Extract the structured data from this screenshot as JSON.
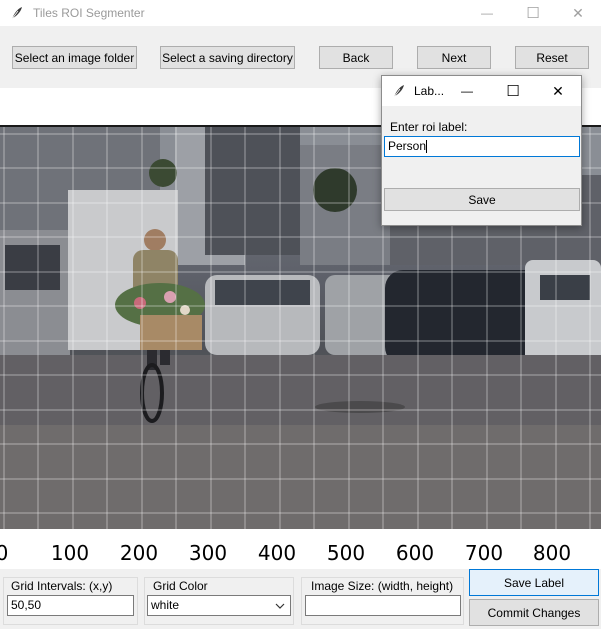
{
  "window": {
    "title": "Tiles ROI Segmenter",
    "minimize_glyph": "—",
    "maximize_glyph": "☐",
    "close_glyph": "✕"
  },
  "toolbar": {
    "select_folder": "Select an image folder",
    "select_saving": "Select a saving directory",
    "back": "Back",
    "next": "Next",
    "reset": "Reset"
  },
  "canvas": {
    "grid_color": "#ffffff",
    "x_ticks": [
      "0",
      "100",
      "200",
      "300",
      "400",
      "500",
      "600",
      "700",
      "800"
    ]
  },
  "bottom": {
    "grid_intervals_label": "Grid Intervals: (x,y)",
    "grid_intervals_value": "50,50",
    "grid_color_label": "Grid Color",
    "grid_color_value": "white",
    "image_size_label": "Image Size: (width, height)",
    "image_size_value": "",
    "save_label_button": "Save Label",
    "commit_changes_button": "Commit Changes"
  },
  "dialog": {
    "title": "Lab...",
    "prompt": "Enter roi label:",
    "value": "Person",
    "save_button": "Save"
  },
  "icons": {
    "app": "feather-icon",
    "minimize": "minimize-icon",
    "maximize": "maximize-icon",
    "close": "close-icon",
    "dropdown": "chevron-down-icon"
  }
}
